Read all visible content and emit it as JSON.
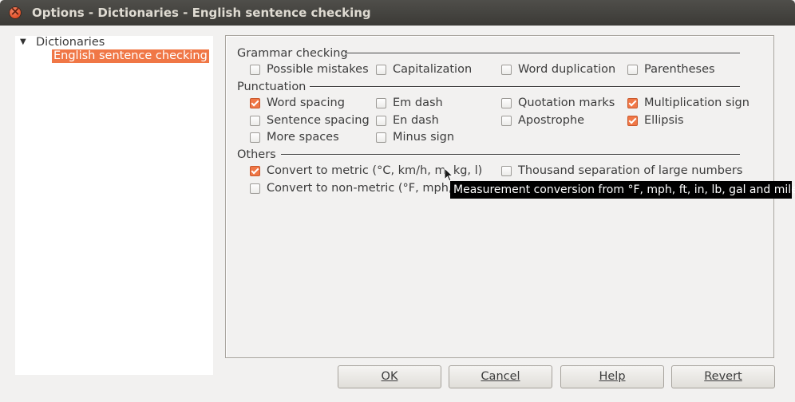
{
  "window": {
    "title": "Options - Dictionaries - English sentence checking"
  },
  "tree": {
    "root": "Dictionaries",
    "child": "English sentence checking"
  },
  "sections": {
    "grammar": "Grammar checking",
    "punctuation": "Punctuation",
    "others": "Others"
  },
  "options": {
    "possible_mistakes": {
      "label": "Possible mistakes",
      "checked": false
    },
    "capitalization": {
      "label": "Capitalization",
      "checked": false
    },
    "word_duplication": {
      "label": "Word duplication",
      "checked": false
    },
    "parentheses": {
      "label": "Parentheses",
      "checked": false
    },
    "word_spacing": {
      "label": "Word spacing",
      "checked": true
    },
    "em_dash": {
      "label": "Em dash",
      "checked": false
    },
    "quotation_marks": {
      "label": "Quotation marks",
      "checked": false
    },
    "multiplication_sign": {
      "label": "Multiplication sign",
      "checked": true
    },
    "sentence_spacing": {
      "label": "Sentence spacing",
      "checked": false
    },
    "en_dash": {
      "label": "En dash",
      "checked": false
    },
    "apostrophe": {
      "label": "Apostrophe",
      "checked": false
    },
    "ellipsis": {
      "label": "Ellipsis",
      "checked": true
    },
    "more_spaces": {
      "label": "More spaces",
      "checked": false
    },
    "minus_sign": {
      "label": "Minus sign",
      "checked": false
    },
    "convert_metric": {
      "label": "Convert to metric (°C, km/h, m, kg, l)",
      "checked": true
    },
    "thousand_separation": {
      "label": "Thousand separation of large numbers",
      "checked": false
    },
    "convert_non_metric": {
      "label": "Convert to non-metric (°F, mph, ft",
      "checked": false
    }
  },
  "tooltip": "Measurement conversion from °F, mph, ft, in, lb, gal and miles.",
  "buttons": {
    "ok": "OK",
    "cancel": "Cancel",
    "help": "Help",
    "revert": "Revert"
  },
  "colors": {
    "accent": "#f07746",
    "titlebar": "#3c3b37"
  }
}
